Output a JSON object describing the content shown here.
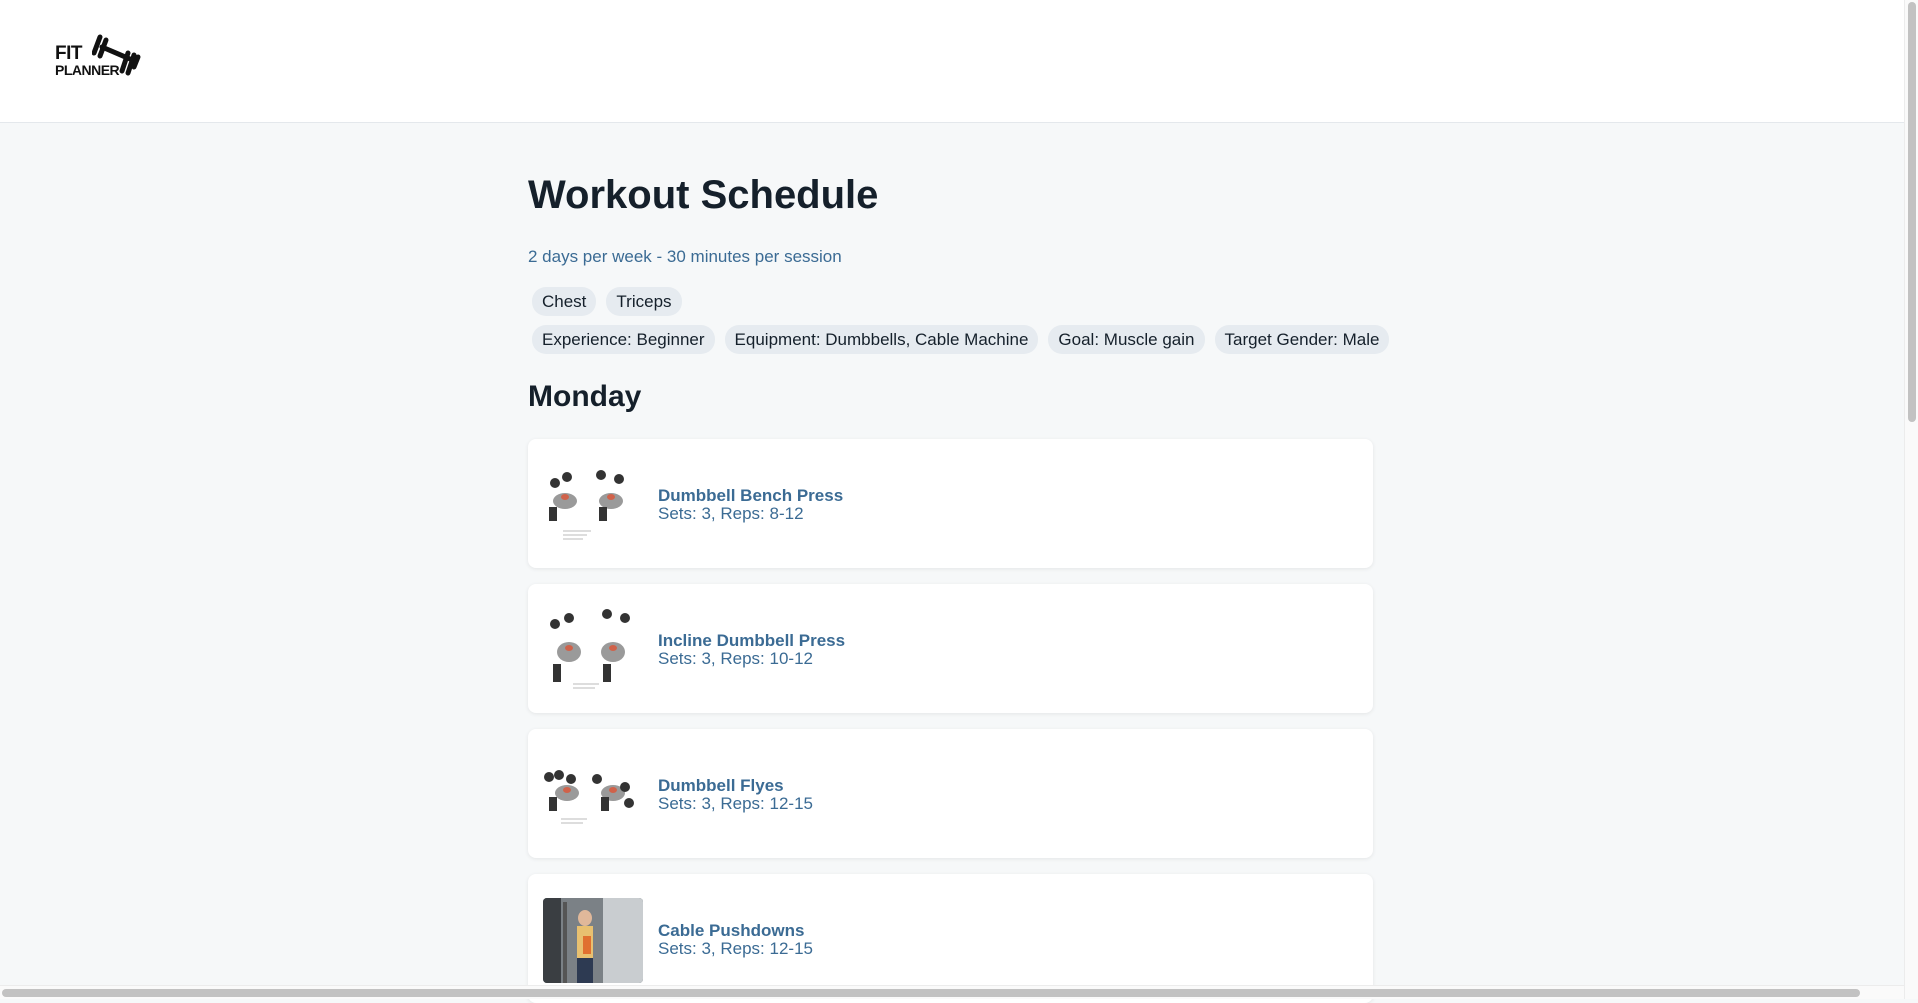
{
  "header": {
    "logo_line1": "FIT",
    "logo_line2": "PLANNER",
    "logo_icon": "dumbbell-icon"
  },
  "main": {
    "title": "Workout Schedule",
    "subtitle": "2 days per week - 30 minutes per session",
    "muscle_tags": [
      "Chest",
      "Triceps"
    ],
    "info_tags": [
      "Experience: Beginner",
      "Equipment: Dumbbells, Cable Machine",
      "Goal: Muscle gain",
      "Target Gender: Male"
    ],
    "day": "Monday",
    "exercises": [
      {
        "name": "Dumbbell Bench Press",
        "detail": "Sets: 3, Reps: 8-12",
        "image": "bench-press-illustration"
      },
      {
        "name": "Incline Dumbbell Press",
        "detail": "Sets: 3, Reps: 10-12",
        "image": "incline-press-illustration"
      },
      {
        "name": "Dumbbell Flyes",
        "detail": "Sets: 3, Reps: 12-15",
        "image": "flyes-illustration"
      },
      {
        "name": "Cable Pushdowns",
        "detail": "Sets: 3, Reps: 12-15",
        "image": "cable-pushdown-photo"
      }
    ]
  },
  "colors": {
    "accent": "#3b6b94",
    "chip_bg": "#e6ebf0",
    "page_bg": "#f6f8f9"
  }
}
